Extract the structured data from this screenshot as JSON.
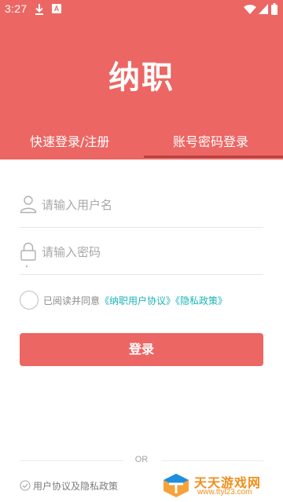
{
  "status_bar": {
    "time": "3:27",
    "notification_badge": "A",
    "icons": [
      "download-icon",
      "a-notification-icon",
      "wifi-icon",
      "signal-icon",
      "battery-icon"
    ]
  },
  "app": {
    "title": "纳职",
    "accent_color": "#ec6663",
    "link_color": "#19b4b8"
  },
  "tabs": [
    {
      "label": "快速登录/注册",
      "active": false
    },
    {
      "label": "账号密码登录",
      "active": true
    }
  ],
  "form": {
    "username": {
      "value": "",
      "placeholder": "请输入用户名",
      "icon": "user-icon"
    },
    "password": {
      "value": "",
      "placeholder": "请输入密码",
      "icon": "lock-icon"
    },
    "agreement": {
      "prefix": "已阅读并同意",
      "user_agreement": "《纳职用户协议》",
      "privacy_policy": "《隐私政策》",
      "checked": false
    },
    "login_label": "登录"
  },
  "footer": {
    "or_text": "OR",
    "privacy_label": "用户协议及隐私政策"
  },
  "watermark": {
    "name": "天天游戏网",
    "url": "www.ttyl23.com"
  }
}
